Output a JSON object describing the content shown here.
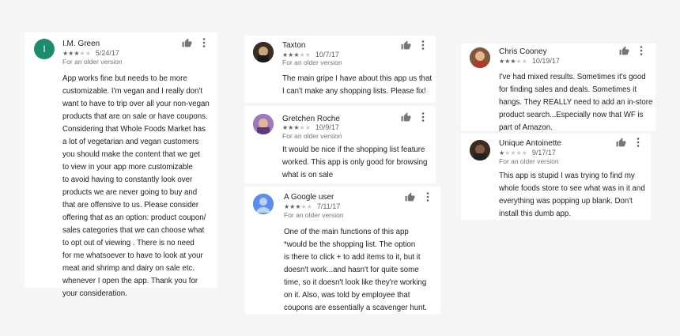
{
  "reviews": [
    {
      "name": "I.M. Green",
      "rating": 3,
      "date": "5/24/17",
      "version": "For an older version",
      "avatar_letter": "I",
      "avatar_color": "#1e8a6e",
      "lines": [
        "App works fine but needs to be more",
        "customizable. I'm vegan and I really don't",
        "want to have to trip over all your non-vegan",
        "products that are on sale or have coupons.",
        "Considering that Whole Foods Market has",
        "a lot of vegetarian and vegan customers",
        "you should make the content that we get",
        "to view in your app more customizable",
        "to avoid having to constantly look over",
        "products we are never going to buy and",
        "that are offensive to us. Please consider",
        "offering that as an option: product coupon/",
        "sales categories that we can choose what",
        "to opt out of viewing . There is no need",
        "for me whatsoever to have to look at your",
        "meat and shrimp and dairy on sale etc.",
        "whenever I open the app. Thank you for",
        "your consideration."
      ]
    },
    {
      "name": "Taxton",
      "rating": 3,
      "date": "10/7/17",
      "version": "For an older version",
      "lines": [
        "The main gripe I have about this app us that",
        "I can't make any shopping lists. Please fix!"
      ]
    },
    {
      "name": "Gretchen Roche",
      "rating": 3,
      "date": "10/9/17",
      "version": "For an older version",
      "lines": [
        "It would be nice if the shopping list feature",
        "worked. This app is only good for browsing",
        "what is on sale"
      ]
    },
    {
      "name": "A Google user",
      "rating": 3,
      "date": "7/11/17",
      "version": "For an older version",
      "lines": [
        "One of the main functions of this app",
        "*would be the shopping list. The option",
        "is there to click + to add items to it, but it",
        "doesn't work...and hasn't for quite some",
        "time, so it doesn't look like they're working",
        "on it. Also, was told by employee that",
        "coupons are essentially a scavenger hunt."
      ]
    },
    {
      "name": "Chris Cooney",
      "rating": 3,
      "date": "10/19/17",
      "version": "",
      "lines": [
        "I've had mixed results. Sometimes it's good",
        "for finding sales and deals. Sometimes it",
        "hangs. They REALLY need to add an in-store",
        "product search...Especially now that WF is",
        "part of Amazon."
      ]
    },
    {
      "name": "Unique Antoinette",
      "rating": 1,
      "date": "9/17/17",
      "version": "For an older version",
      "lines": [
        "This app is stupid I was trying to find my",
        "whole foods store to see what was in it and",
        "everything was popping up blank. Don't",
        "install this dumb app."
      ]
    }
  ]
}
